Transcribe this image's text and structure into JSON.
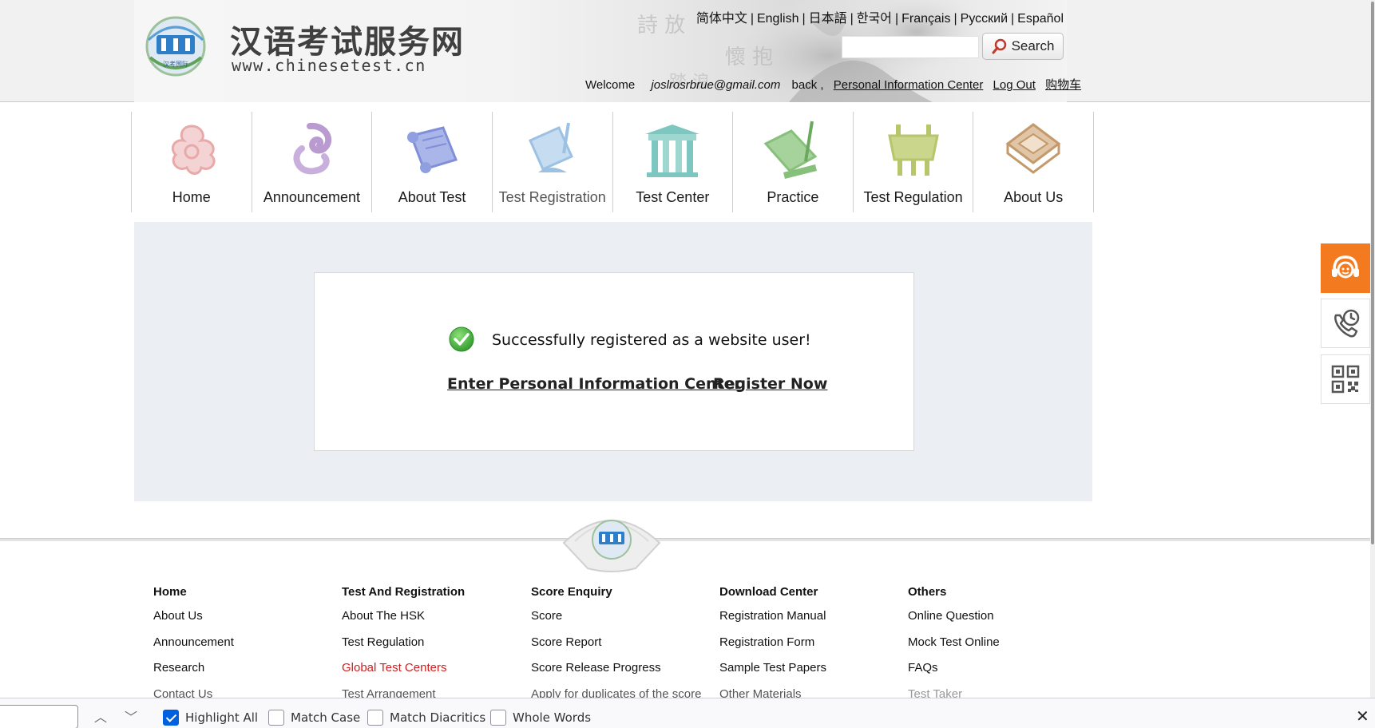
{
  "header": {
    "logo_title": "汉语考试服务网",
    "logo_url": "www.chinesetest.cn",
    "emblem_text": "汉考国际",
    "languages": [
      "简体中文",
      "English",
      "日本語",
      "한국어",
      "Français",
      "Русский",
      "Español"
    ],
    "search_placeholder": "",
    "search_button": "Search",
    "welcome": "Welcome",
    "user_email": "joslrosrbrue@gmail.com",
    "back": "back ,",
    "personal_center_link": "Personal Information Center",
    "logout_link": "Log Out",
    "cart_link": "购物车"
  },
  "nav": {
    "items": [
      {
        "label": "Home",
        "icon": "home-cloud-icon",
        "color": "#e8a9a9"
      },
      {
        "label": "Announcement",
        "icon": "announcement-swirl-icon",
        "color": "#b99bd0"
      },
      {
        "label": "About Test",
        "icon": "scroll-icon",
        "color": "#8f9fe0"
      },
      {
        "label": "Test Registration",
        "icon": "brush-scroll-icon",
        "color": "#9dc1e3"
      },
      {
        "label": "Test Center",
        "icon": "pavilion-icon",
        "color": "#7dc7c0"
      },
      {
        "label": "Practice",
        "icon": "book-pen-icon",
        "color": "#86c07a"
      },
      {
        "label": "Test Regulation",
        "icon": "ding-vessel-icon",
        "color": "#b6c66b"
      },
      {
        "label": "About Us",
        "icon": "seal-box-icon",
        "color": "#c49a6c"
      }
    ]
  },
  "main": {
    "success_message": "Successfully registered as a website user!",
    "enter_center_link": "Enter Personal Information Center",
    "register_now_link": "Register Now"
  },
  "footer": {
    "columns": [
      {
        "title": "Home",
        "items": [
          "About Us",
          "Announcement",
          "Research",
          "Contact Us"
        ]
      },
      {
        "title": "Test And Registration",
        "items": [
          "About The HSK",
          "Test Regulation",
          "Global Test Centers",
          "Test Arrangement"
        ],
        "highlight_index": 2
      },
      {
        "title": "Score Enquiry",
        "items": [
          "Score",
          "Score Report",
          "Score Release Progress",
          "Apply for duplicates of the score"
        ]
      },
      {
        "title": "Download Center",
        "items": [
          "Registration Manual",
          "Registration Form",
          "Sample Test Papers",
          "Other Materials"
        ]
      },
      {
        "title": "Others",
        "items": [
          "Online Question",
          "Mock Test Online",
          "FAQs",
          "Test Taker"
        ]
      }
    ]
  },
  "side_tools": [
    "headset-icon",
    "phone-clock-icon",
    "qr-code-icon"
  ],
  "findbar": {
    "query": "",
    "options": [
      {
        "label": "Highlight All",
        "checked": true
      },
      {
        "label": "Match Case",
        "checked": false
      },
      {
        "label": "Match Diacritics",
        "checked": false
      },
      {
        "label": "Whole Words",
        "checked": false
      }
    ],
    "close": "✕",
    "prev": "︿",
    "next": "﹀"
  },
  "colors": {
    "accent_orange": "#f47a20",
    "highlight_red": "#d21e1e",
    "panel_bg": "#ebeff3"
  }
}
